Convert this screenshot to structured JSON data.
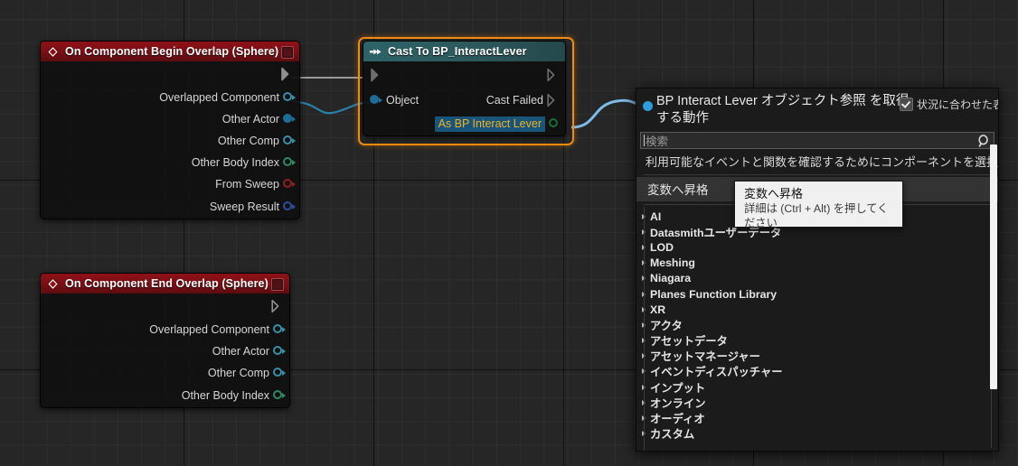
{
  "canvas": {
    "background": "#262626",
    "grid_color": "#333333"
  },
  "nodes": [
    {
      "id": "on-begin-overlap",
      "title": "On Component Begin Overlap (Sphere)",
      "kind": "event",
      "icon": "event-diamond-icon",
      "delegate_icon": "delegate-square-icon",
      "header_color": "#7c1015",
      "selected": false,
      "exec_out": true,
      "pins": [
        {
          "label": "Overlapped Component",
          "color": "#3a8fa8",
          "filled": false
        },
        {
          "label": "Other Actor",
          "color": "#1c6e96",
          "filled": true
        },
        {
          "label": "Other Comp",
          "color": "#3a8fa8",
          "filled": false
        },
        {
          "label": "Other Body Index",
          "color": "#2e8a63",
          "filled": false
        },
        {
          "label": "From Sweep",
          "color": "#8c2020",
          "filled": false
        },
        {
          "label": "Sweep Result",
          "color": "#2a4f9e",
          "filled": false
        }
      ]
    },
    {
      "id": "on-end-overlap",
      "title": "On Component End Overlap (Sphere)",
      "kind": "event",
      "icon": "event-diamond-icon",
      "delegate_icon": "delegate-square-icon",
      "header_color": "#7c1015",
      "selected": false,
      "exec_out": true,
      "pins": [
        {
          "label": "Overlapped Component",
          "color": "#3a8fa8",
          "filled": false
        },
        {
          "label": "Other Actor",
          "color": "#3a8fa8",
          "filled": false
        },
        {
          "label": "Other Comp",
          "color": "#3a8fa8",
          "filled": false
        },
        {
          "label": "Other Body Index",
          "color": "#2e8a63",
          "filled": false
        }
      ]
    },
    {
      "id": "cast-to-bp-interactlever",
      "title": "Cast To BP_InteractLever",
      "kind": "cast",
      "icon": "cast-arrow-icon",
      "header_color": "#2c585c",
      "selected": true,
      "selection_color": "#ef8a12",
      "input_label": "Object",
      "input_color": "#1c6e96",
      "output_exec_label": "Cast Failed",
      "output_label": "As BP Interact Lever",
      "output_label_color": "#f0b024",
      "output_label_bg": "#19557a",
      "output_pin_color": "#1b6b3a"
    }
  ],
  "context_menu": {
    "dot_color": "#2d9cdb",
    "title": "BP Interact Lever オブジェクト参照 を取得する動作",
    "context_checkbox": {
      "label": "状況に合わせた表示",
      "checked": true
    },
    "search": {
      "placeholder": "検索",
      "value": "",
      "icon": "search-magnifier-icon"
    },
    "hint": "利用可能なイベントと関数を確認するためにコンポーネントを選択",
    "promote_item": "変数へ昇格",
    "categories": [
      "AI",
      "Datasmithユーザーデータ",
      "LOD",
      "Meshing",
      "Niagara",
      "Planes Function Library",
      "XR",
      "アクタ",
      "アセットデータ",
      "アセットマネージャー",
      "イベントディスパッチャー",
      "インプット",
      "オンライン",
      "オーディオ",
      "カスタム"
    ]
  },
  "tooltip": {
    "title": "変数へ昇格",
    "subtitle": "詳細は (Ctrl + Alt) を押してください"
  }
}
